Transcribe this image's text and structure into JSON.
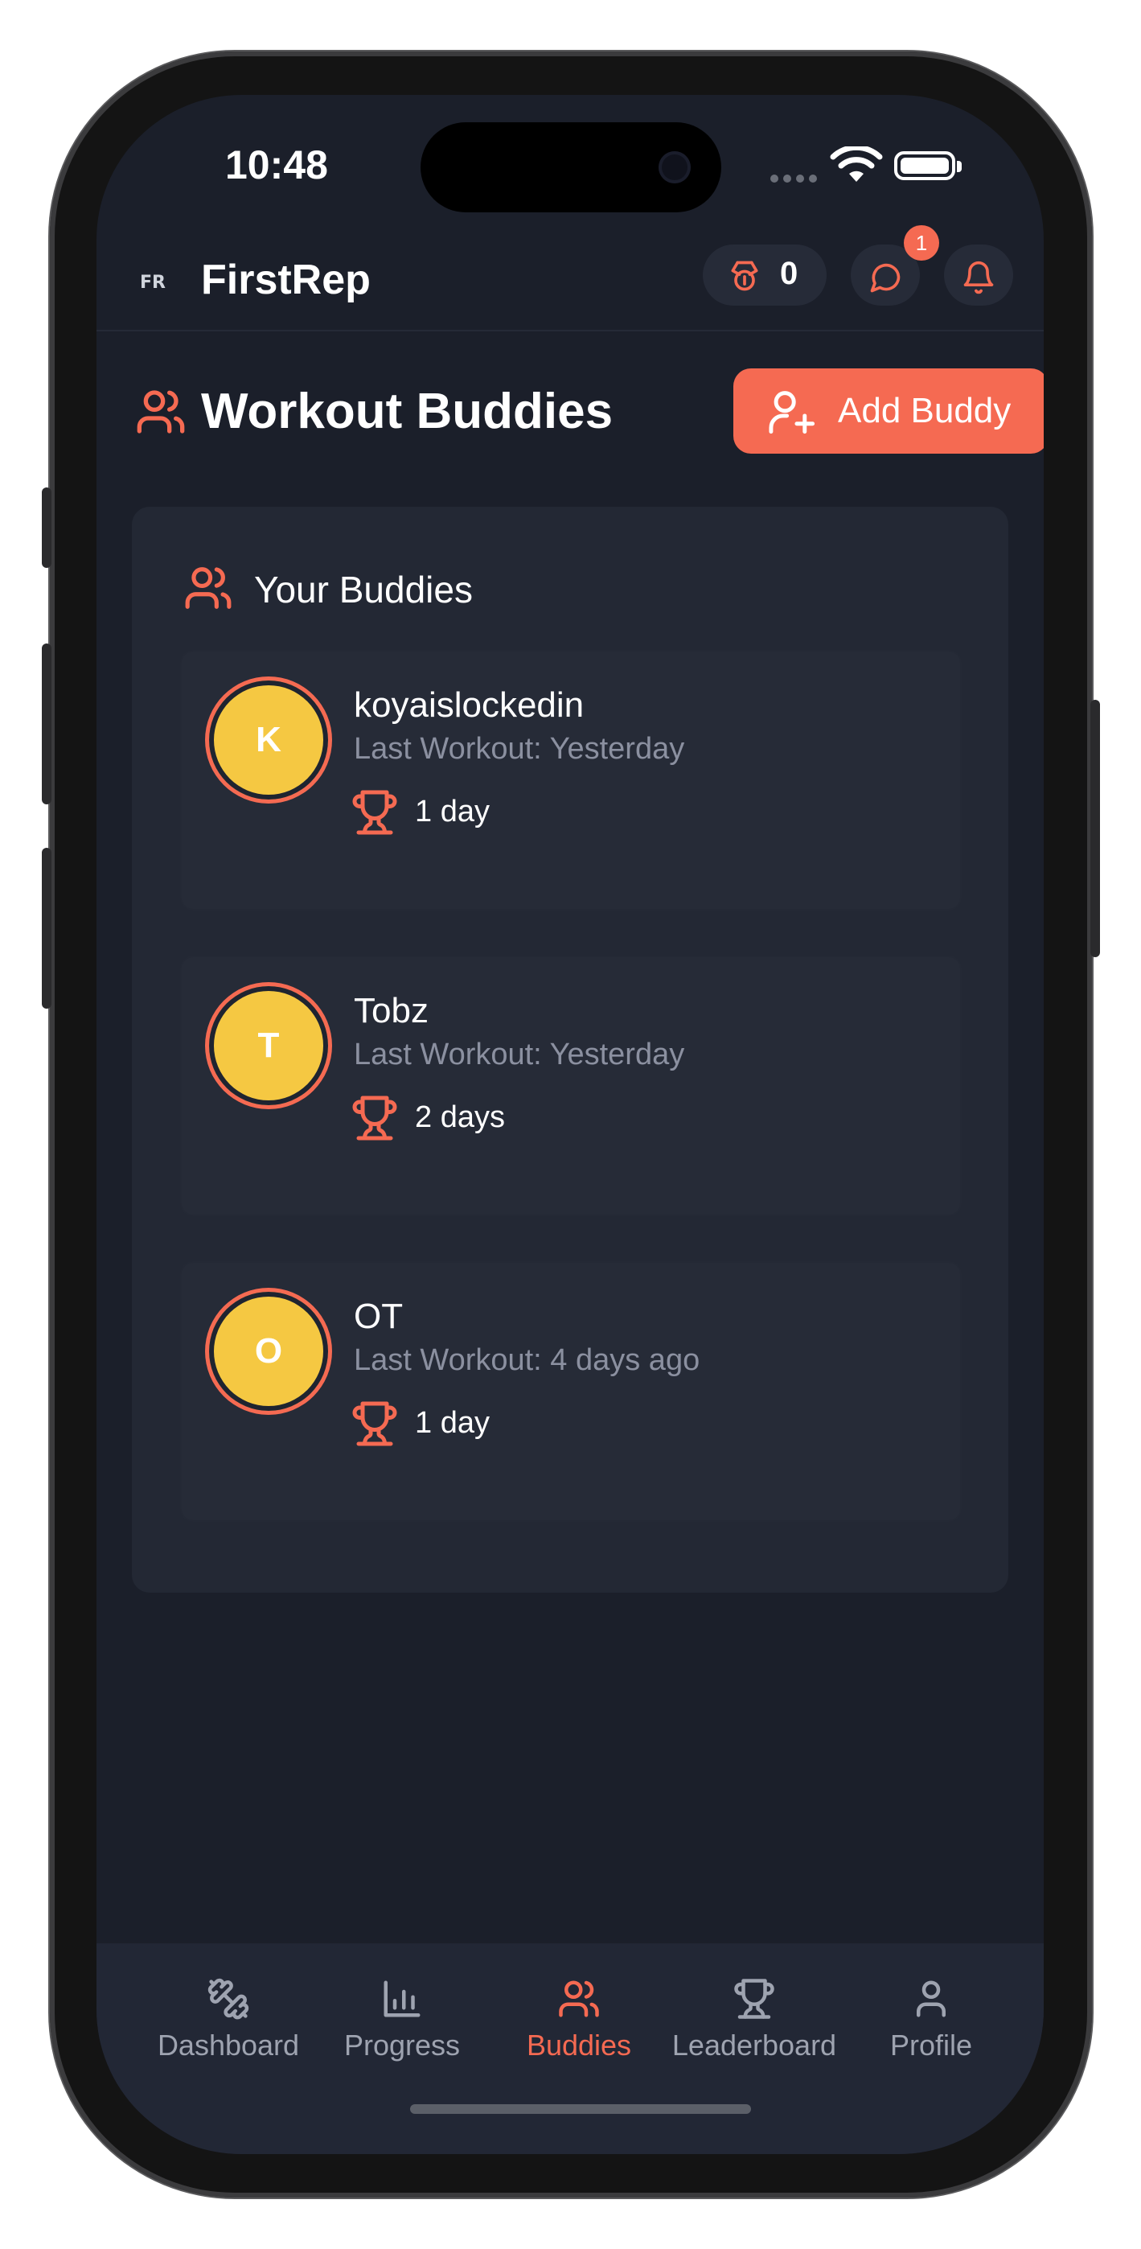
{
  "status_bar": {
    "time": "10:48"
  },
  "header": {
    "app_title": "FirstRep",
    "logo_icon": "firstrep-logo-icon",
    "medal_count": "0",
    "chat_badge": "1"
  },
  "page": {
    "title": "Workout Buddies",
    "add_button_label": "Add Buddy"
  },
  "buddies_card": {
    "title": "Your Buddies",
    "buddies": [
      {
        "initial": "K",
        "name": "koyaislockedin",
        "last_workout": "Last Workout: Yesterday",
        "streak": "1 day"
      },
      {
        "initial": "T",
        "name": "Tobz",
        "last_workout": "Last Workout: Yesterday",
        "streak": "2 days"
      },
      {
        "initial": "O",
        "name": "OT",
        "last_workout": "Last Workout: 4 days ago",
        "streak": "1 day"
      }
    ]
  },
  "nav": {
    "items": [
      {
        "label": "Dashboard",
        "icon": "dumbbell-icon"
      },
      {
        "label": "Progress",
        "icon": "bar-chart-icon"
      },
      {
        "label": "Buddies",
        "icon": "users-icon"
      },
      {
        "label": "Leaderboard",
        "icon": "trophy-icon"
      },
      {
        "label": "Profile",
        "icon": "user-icon"
      }
    ],
    "active": "Buddies"
  },
  "colors": {
    "accent": "#f56a52",
    "background": "#1b1f2a",
    "card": "#232834",
    "avatar": "#f5c842",
    "muted_text": "#8b90a0"
  }
}
